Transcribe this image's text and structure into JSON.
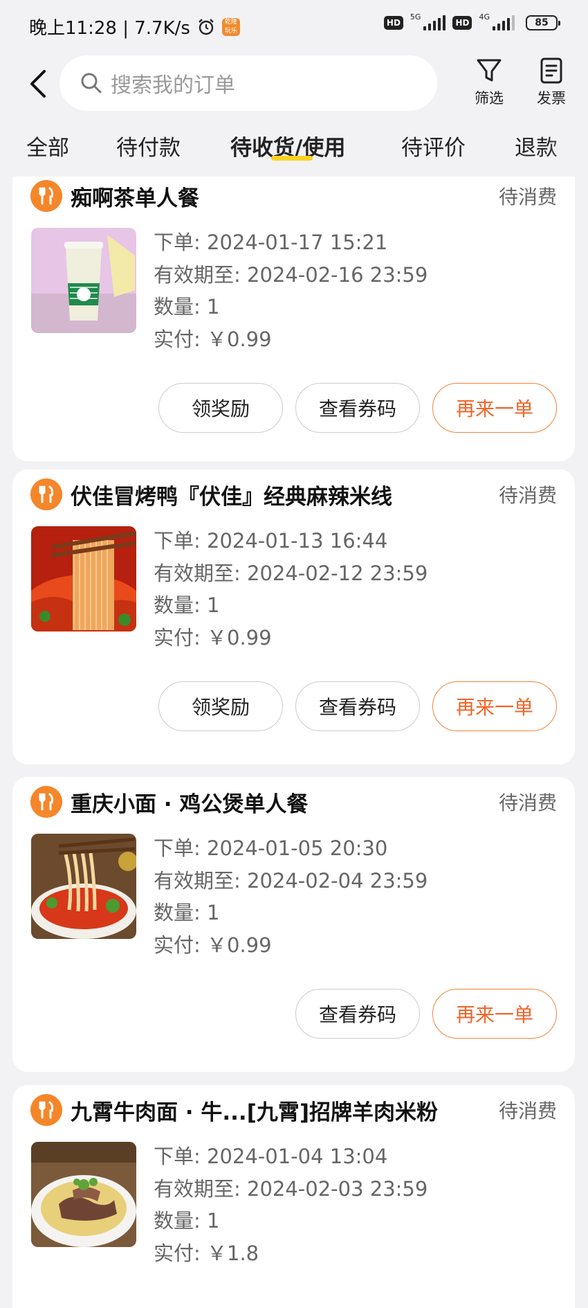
{
  "status_bar": {
    "time": "晚上11:28 | 7.7K/s",
    "hd1": "HD",
    "net1": "5G",
    "hd2": "HD",
    "net2": "4G",
    "battery": "85",
    "app_badge": "乾隆 玩乐"
  },
  "header": {
    "search_placeholder": "搜索我的订单",
    "filter_label": "筛选",
    "invoice_label": "发票"
  },
  "tabs": [
    {
      "label": "全部"
    },
    {
      "label": "待付款"
    },
    {
      "label": "待收货/使用",
      "active": true
    },
    {
      "label": "待评价"
    },
    {
      "label": "退款"
    }
  ],
  "orders": [
    {
      "shop": "痴啊茶单人餐",
      "status": "待消费",
      "order_time": "下单: 2024-01-17 15:21",
      "valid_until": "有效期至: 2024-02-16 23:59",
      "quantity": "数量: 1",
      "paid": "实付: ￥0.99",
      "image": "milk-tea",
      "buttons": [
        "领奖励",
        "查看券码",
        "再来一单"
      ]
    },
    {
      "shop": "伏佳冒烤鸭『伏佳』经典麻辣米线",
      "status": "待消费",
      "order_time": "下单: 2024-01-13 16:44",
      "valid_until": "有效期至: 2024-02-12 23:59",
      "quantity": "数量: 1",
      "paid": "实付: ￥0.99",
      "image": "spicy-rice-noodles",
      "buttons": [
        "领奖励",
        "查看券码",
        "再来一单"
      ]
    },
    {
      "shop": "重庆小面 · 鸡公煲单人餐",
      "status": "待消费",
      "order_time": "下单: 2024-01-05 20:30",
      "valid_until": "有效期至: 2024-02-04 23:59",
      "quantity": "数量: 1",
      "paid": "实付: ￥0.99",
      "image": "chongqing-noodles",
      "buttons": [
        "查看券码",
        "再来一单"
      ]
    },
    {
      "shop": "九霄牛肉面 · 牛...[九霄]招牌羊肉米粉",
      "status": "待消费",
      "order_time": "下单: 2024-01-04 13:04",
      "valid_until": "有效期至: 2024-02-03 23:59",
      "quantity": "数量: 1",
      "paid": "实付: ￥1.8",
      "image": "lamb-rice-noodles",
      "buttons": []
    }
  ],
  "colors": {
    "accent": "#f0662a",
    "shop_icon": "#f5862a",
    "tab_underline": "#ffd21f",
    "background": "#f2f2f5"
  }
}
